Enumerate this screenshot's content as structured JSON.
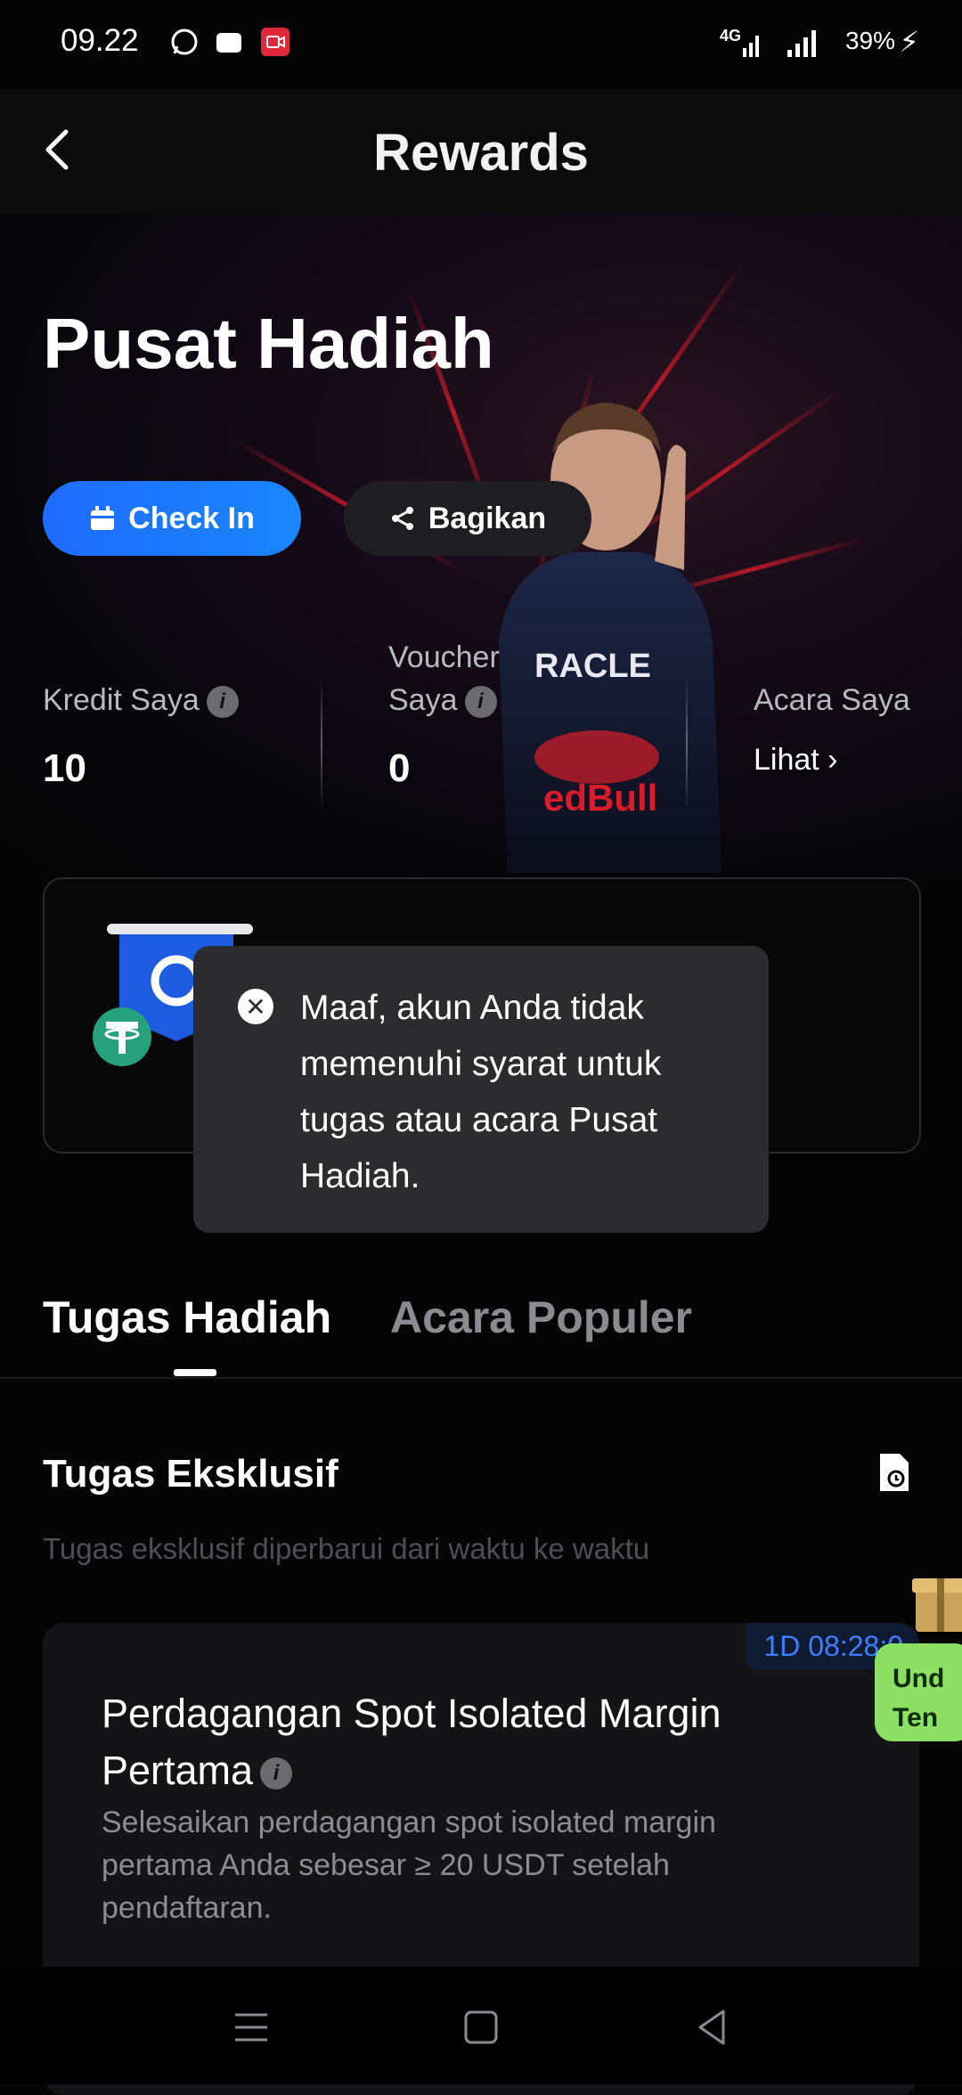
{
  "status_bar": {
    "time": "09.22",
    "network": "4G",
    "battery": "39%"
  },
  "header": {
    "title": "Rewards"
  },
  "hero": {
    "title": "Pusat Hadiah",
    "checkin_label": "Check In",
    "share_label": "Bagikan",
    "stats": {
      "credit_label": "Kredit Saya",
      "credit_value": "10",
      "voucher_label_line1": "Voucher",
      "voucher_label_line2": "Saya",
      "voucher_value": "0",
      "events_label": "Acara Saya",
      "events_link": "Lihat"
    }
  },
  "toast": {
    "message": "Maaf, akun Anda tidak memenuhi syarat untuk tugas atau acara Pusat Hadiah."
  },
  "tabs": [
    {
      "label": "Tugas Hadiah",
      "active": true
    },
    {
      "label": "Acara Populer",
      "active": false
    }
  ],
  "section": {
    "title": "Tugas Eksklusif",
    "subtitle": "Tugas eksklusif diperbarui dari waktu ke waktu"
  },
  "task_card": {
    "timer": "1D 08:28:0",
    "title_line1": "Perdagangan Spot Isolated Margin",
    "title_line2": "Pertama",
    "description": "Selesaikan perdagangan spot isolated margin pertama Anda sebesar ≥ 20 USDT setelah pendaftaran."
  },
  "promo": {
    "line1": "Und",
    "line2": "Ten"
  },
  "colors": {
    "accent_blue": "#1e6bff",
    "promo_green": "#8de063",
    "toast_bg": "#2c2c2f",
    "ray_red": "#d81c2a"
  },
  "icons": [
    "back-arrow-icon",
    "calendar-icon",
    "share-icon",
    "info-icon",
    "chevron-right-icon",
    "close-circle-icon",
    "document-icon",
    "tether-icon",
    "gift-icon",
    "menu-nav-icon",
    "home-nav-icon",
    "back-nav-icon"
  ]
}
